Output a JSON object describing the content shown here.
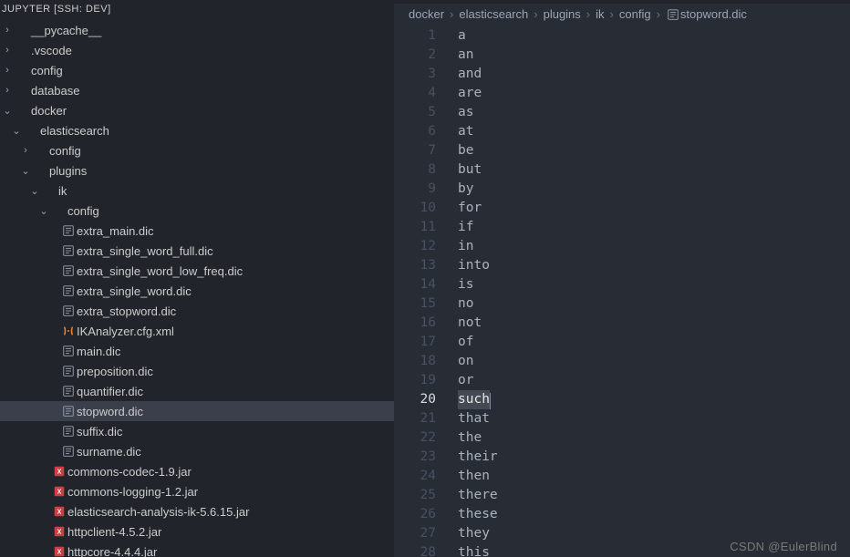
{
  "sidebar_title": "JUPYTER [SSH: DEV]",
  "tree": [
    {
      "depth": 0,
      "type": "folder",
      "chev": "right",
      "name": "__pycache__",
      "active": false
    },
    {
      "depth": 0,
      "type": "folder",
      "chev": "right",
      "name": ".vscode",
      "active": false
    },
    {
      "depth": 0,
      "type": "folder",
      "chev": "right",
      "name": "config",
      "active": false
    },
    {
      "depth": 0,
      "type": "folder",
      "chev": "right",
      "name": "database",
      "active": false
    },
    {
      "depth": 0,
      "type": "folder",
      "chev": "down",
      "name": "docker",
      "active": false
    },
    {
      "depth": 1,
      "type": "folder",
      "chev": "down",
      "name": "elasticsearch",
      "active": false
    },
    {
      "depth": 2,
      "type": "folder",
      "chev": "right",
      "name": "config",
      "active": false
    },
    {
      "depth": 2,
      "type": "folder",
      "chev": "down",
      "name": "plugins",
      "active": false
    },
    {
      "depth": 3,
      "type": "folder",
      "chev": "down",
      "name": "ik",
      "active": false
    },
    {
      "depth": 4,
      "type": "folder",
      "chev": "down",
      "name": "config",
      "active": false
    },
    {
      "depth": 5,
      "type": "file-lines",
      "chev": "",
      "name": "extra_main.dic",
      "active": false
    },
    {
      "depth": 5,
      "type": "file-lines",
      "chev": "",
      "name": "extra_single_word_full.dic",
      "active": false
    },
    {
      "depth": 5,
      "type": "file-lines",
      "chev": "",
      "name": "extra_single_word_low_freq.dic",
      "active": false
    },
    {
      "depth": 5,
      "type": "file-lines",
      "chev": "",
      "name": "extra_single_word.dic",
      "active": false
    },
    {
      "depth": 5,
      "type": "file-lines",
      "chev": "",
      "name": "extra_stopword.dic",
      "active": false
    },
    {
      "depth": 5,
      "type": "file-xml",
      "chev": "",
      "name": "IKAnalyzer.cfg.xml",
      "active": false
    },
    {
      "depth": 5,
      "type": "file-lines",
      "chev": "",
      "name": "main.dic",
      "active": false
    },
    {
      "depth": 5,
      "type": "file-lines",
      "chev": "",
      "name": "preposition.dic",
      "active": false
    },
    {
      "depth": 5,
      "type": "file-lines",
      "chev": "",
      "name": "quantifier.dic",
      "active": false
    },
    {
      "depth": 5,
      "type": "file-lines",
      "chev": "",
      "name": "stopword.dic",
      "active": true
    },
    {
      "depth": 5,
      "type": "file-lines",
      "chev": "",
      "name": "suffix.dic",
      "active": false
    },
    {
      "depth": 5,
      "type": "file-lines",
      "chev": "",
      "name": "surname.dic",
      "active": false
    },
    {
      "depth": 4,
      "type": "file-jar",
      "chev": "",
      "name": "commons-codec-1.9.jar",
      "active": false
    },
    {
      "depth": 4,
      "type": "file-jar",
      "chev": "",
      "name": "commons-logging-1.2.jar",
      "active": false
    },
    {
      "depth": 4,
      "type": "file-jar",
      "chev": "",
      "name": "elasticsearch-analysis-ik-5.6.15.jar",
      "active": false
    },
    {
      "depth": 4,
      "type": "file-jar",
      "chev": "",
      "name": "httpclient-4.5.2.jar",
      "active": false
    },
    {
      "depth": 4,
      "type": "file-jar",
      "chev": "",
      "name": "httpcore-4.4.4.jar",
      "active": false,
      "cut": true
    }
  ],
  "breadcrumb": [
    {
      "name": "docker",
      "icon": ""
    },
    {
      "name": "elasticsearch",
      "icon": ""
    },
    {
      "name": "plugins",
      "icon": ""
    },
    {
      "name": "ik",
      "icon": ""
    },
    {
      "name": "config",
      "icon": ""
    },
    {
      "name": "stopword.dic",
      "icon": "file-lines"
    }
  ],
  "file_lines": [
    "a",
    "an",
    "and",
    "are",
    "as",
    "at",
    "be",
    "but",
    "by",
    "for",
    "if",
    "in",
    "into",
    "is",
    "no",
    "not",
    "of",
    "on",
    "or",
    "such",
    "that",
    "the",
    "their",
    "then",
    "there",
    "these",
    "they",
    "this"
  ],
  "selected_line": 20,
  "watermark": "CSDN @EulerBlind"
}
